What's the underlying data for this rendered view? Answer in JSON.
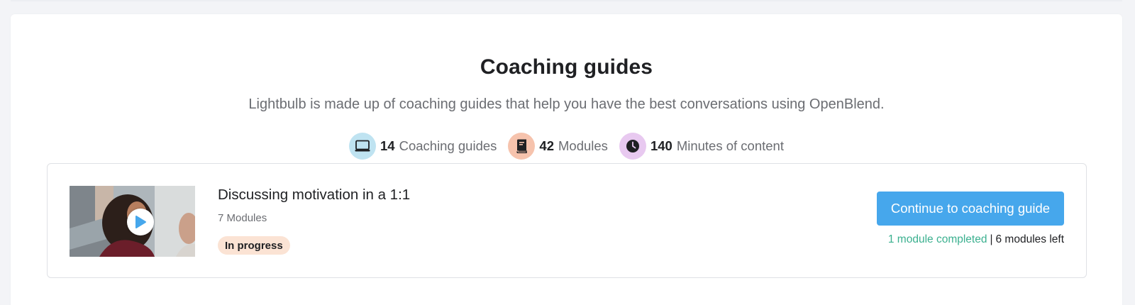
{
  "header": {
    "title": "Coaching guides",
    "subtitle": "Lightbulb is made up of coaching guides that help you have the best conversations using OpenBlend."
  },
  "stats": [
    {
      "icon": "monitor-icon",
      "value": "14",
      "label": "Coaching guides",
      "color": "#bfe3f1"
    },
    {
      "icon": "book-icon",
      "value": "42",
      "label": "Modules",
      "color": "#f6c3ad"
    },
    {
      "icon": "clock-icon",
      "value": "140",
      "label": "Minutes of content",
      "color": "#e8c9f0"
    }
  ],
  "guide": {
    "title": "Discussing motivation in a 1:1",
    "modules": "7 Modules",
    "status": "In progress",
    "button_label": "Continue to coaching guide",
    "completed_text": "1 module completed",
    "separator": "|",
    "remaining_text": "6 modules left",
    "thumbnail_icon": "play-icon"
  },
  "colors": {
    "accent": "#46a7ec",
    "completed": "#3bb08f",
    "badge_bg": "#fbe3d4"
  }
}
